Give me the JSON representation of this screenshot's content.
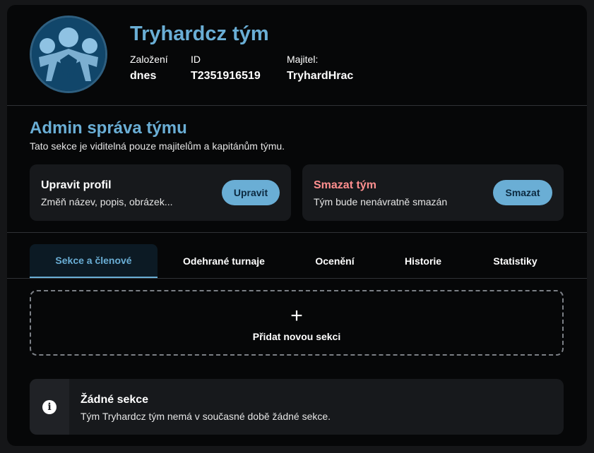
{
  "team": {
    "name": "Tryhardcz tým",
    "meta": [
      {
        "label": "Založení",
        "value": "dnes"
      },
      {
        "label": "ID",
        "value": "T2351916519"
      },
      {
        "label": "Majitel:",
        "value": "TryhardHrac"
      }
    ]
  },
  "admin": {
    "title": "Admin správa týmu",
    "description": "Tato sekce je viditelná pouze majitelům a kapitánům týmu.",
    "edit": {
      "title": "Upravit profil",
      "description": "Změň název, popis, obrázek...",
      "button": "Upravit"
    },
    "delete": {
      "title": "Smazat tým",
      "description": "Tým bude nenávratně smazán",
      "button": "Smazat"
    }
  },
  "tabs": [
    {
      "label": "Sekce a členové",
      "active": true
    },
    {
      "label": "Odehrané turnaje",
      "active": false
    },
    {
      "label": "Ocenění",
      "active": false
    },
    {
      "label": "Historie",
      "active": false
    },
    {
      "label": "Statistiky",
      "active": false
    }
  ],
  "add_section": {
    "icon": "plus-icon",
    "label": "Přidat novou sekci"
  },
  "empty_state": {
    "icon": "info-icon",
    "title": "Žádné sekce",
    "description": "Tým Tryhardcz tým nemá v současné době žádné sekce."
  },
  "colors": {
    "accent": "#6aaed5",
    "danger": "#ff8f8f",
    "background": "#060708",
    "panel": "#17191c"
  }
}
